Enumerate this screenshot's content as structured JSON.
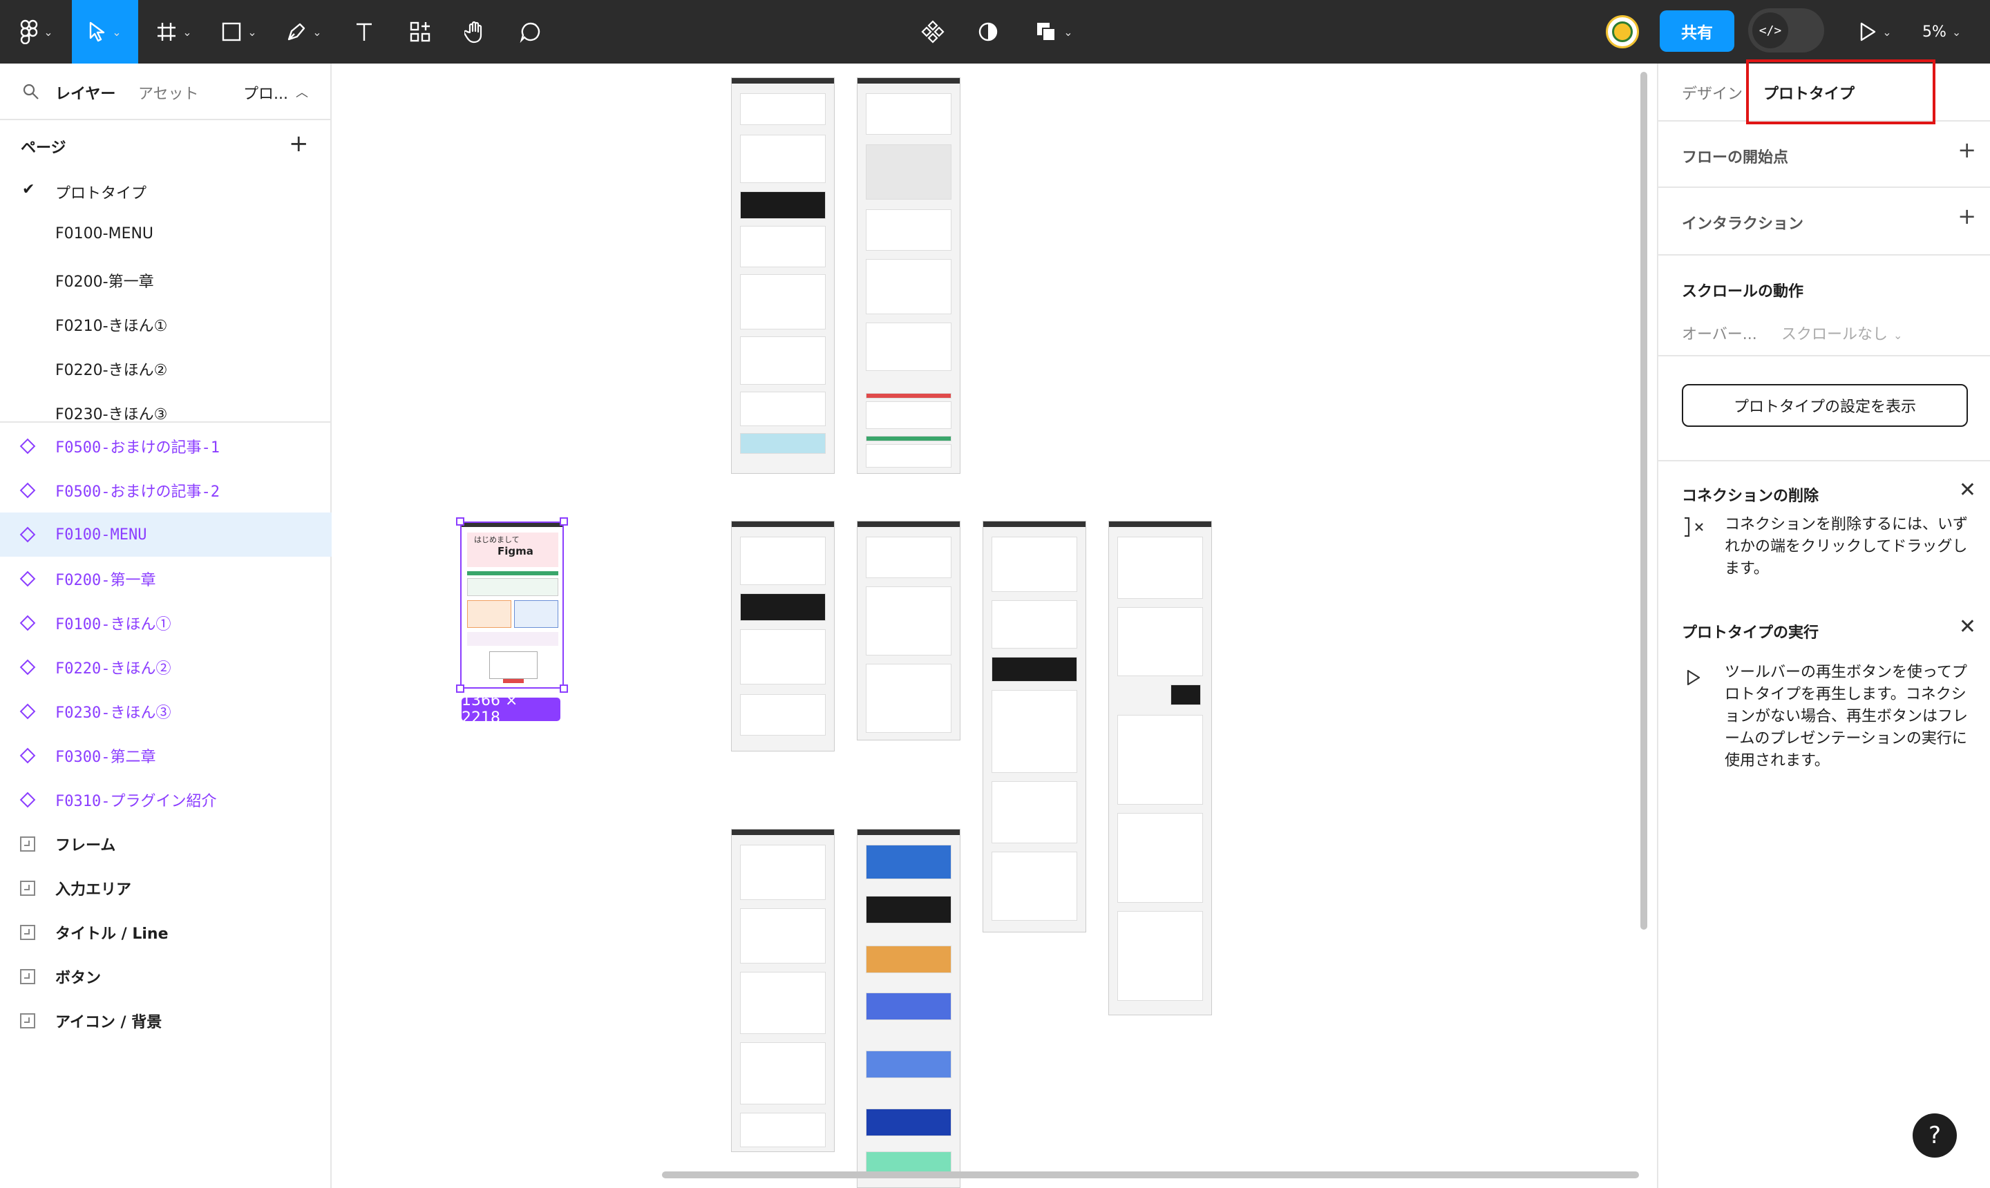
{
  "toolbar": {
    "share_label": "共有",
    "dev_mode_icon": "</>",
    "zoom": "5%"
  },
  "left_panel": {
    "tabs": {
      "layers": "レイヤー",
      "assets": "アセット",
      "page_menu": "プロ..."
    },
    "pages_header": "ページ",
    "pages": [
      {
        "name": "プロトタイプ",
        "current": true
      },
      {
        "name": "F0100-MENU"
      },
      {
        "name": "F0200-第一章"
      },
      {
        "name": "F0210-きほん①"
      },
      {
        "name": "F0220-きほん②"
      },
      {
        "name": "F0230-きほん③"
      }
    ],
    "layers": [
      {
        "name": "F0500-おまけの記事-1",
        "type": "component"
      },
      {
        "name": "F0500-おまけの記事-2",
        "type": "component"
      },
      {
        "name": "F0100-MENU",
        "type": "component",
        "selected": true
      },
      {
        "name": "F0200-第一章",
        "type": "component"
      },
      {
        "name": "F0100-きほん①",
        "type": "component"
      },
      {
        "name": "F0220-きほん②",
        "type": "component"
      },
      {
        "name": "F0230-きほん③",
        "type": "component"
      },
      {
        "name": "F0300-第二章",
        "type": "component"
      },
      {
        "name": "F0310-プラグイン紹介",
        "type": "component"
      },
      {
        "name": "フレーム",
        "type": "frame"
      },
      {
        "name": "入力エリア",
        "type": "frame"
      },
      {
        "name": "タイトル / Line",
        "type": "frame"
      },
      {
        "name": "ボタン",
        "type": "frame"
      },
      {
        "name": "アイコン / 背景",
        "type": "frame"
      }
    ]
  },
  "canvas": {
    "selection_size": "1366 × 2218",
    "selected_frame_heading": "はじめまして",
    "selected_frame_title": "Figma"
  },
  "right_panel": {
    "tabs": {
      "design": "デザイン",
      "prototype": "プロトタイプ"
    },
    "flow_start": "フローの開始点",
    "interactions": "インタラクション",
    "scroll_behavior": "スクロールの動作",
    "overflow_label": "オーバー...",
    "overflow_value": "スクロールなし",
    "show_settings": "プロトタイプの設定を表示",
    "delete_connection": {
      "title": "コネクションの削除",
      "body": "コネクションを削除するには、いずれかの端をクリックしてドラッグします。"
    },
    "run_prototype": {
      "title": "プロトタイプの実行",
      "body": "ツールバーの再生ボタンを使ってプロトタイプを再生します。コネクションがない場合、再生ボタンはフレームのプレゼンテーションの実行に使用されます。"
    }
  },
  "colors": {
    "accent": "#0d99ff",
    "component": "#8b3dff",
    "highlight": "#e01515",
    "toolbar": "#2c2c2c"
  }
}
